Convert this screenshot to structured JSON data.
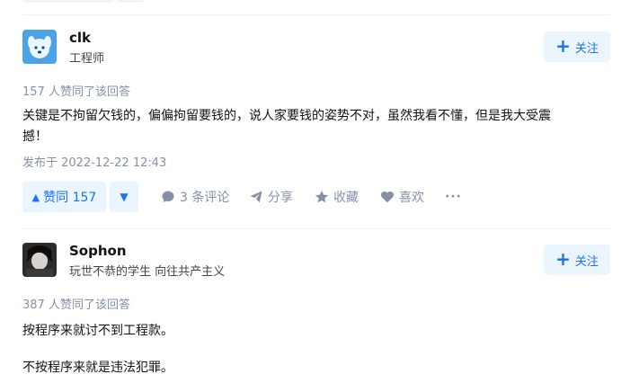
{
  "answers": [
    {
      "author": {
        "name": "clk",
        "bio": "工程师"
      },
      "follow_label": "关注",
      "votes_text": "157 人赞同了该回答",
      "content": [
        "关键是不拘留欠钱的，偏偏拘留要钱的，说人家要钱的姿势不对，虽然我看不懂，但是我大受震",
        "撼！"
      ],
      "publish_time": "发布于 2022-12-22 12:43",
      "actions": {
        "upvote": "赞同 157",
        "comments": "3 条评论",
        "share": "分享",
        "favorite": "收藏",
        "like": "喜欢",
        "more": "···"
      }
    },
    {
      "author": {
        "name": "Sophon",
        "bio": "玩世不恭的学生 向往共产主义"
      },
      "follow_label": "关注",
      "votes_text": "387 人赞同了该回答",
      "content": [
        "按程序来就讨不到工程款。",
        "不按程序来就是违法犯罪。"
      ]
    }
  ],
  "colors": {
    "accent": "#1772f6",
    "accent_bg": "#ebf5ff",
    "muted": "#8590a6"
  }
}
